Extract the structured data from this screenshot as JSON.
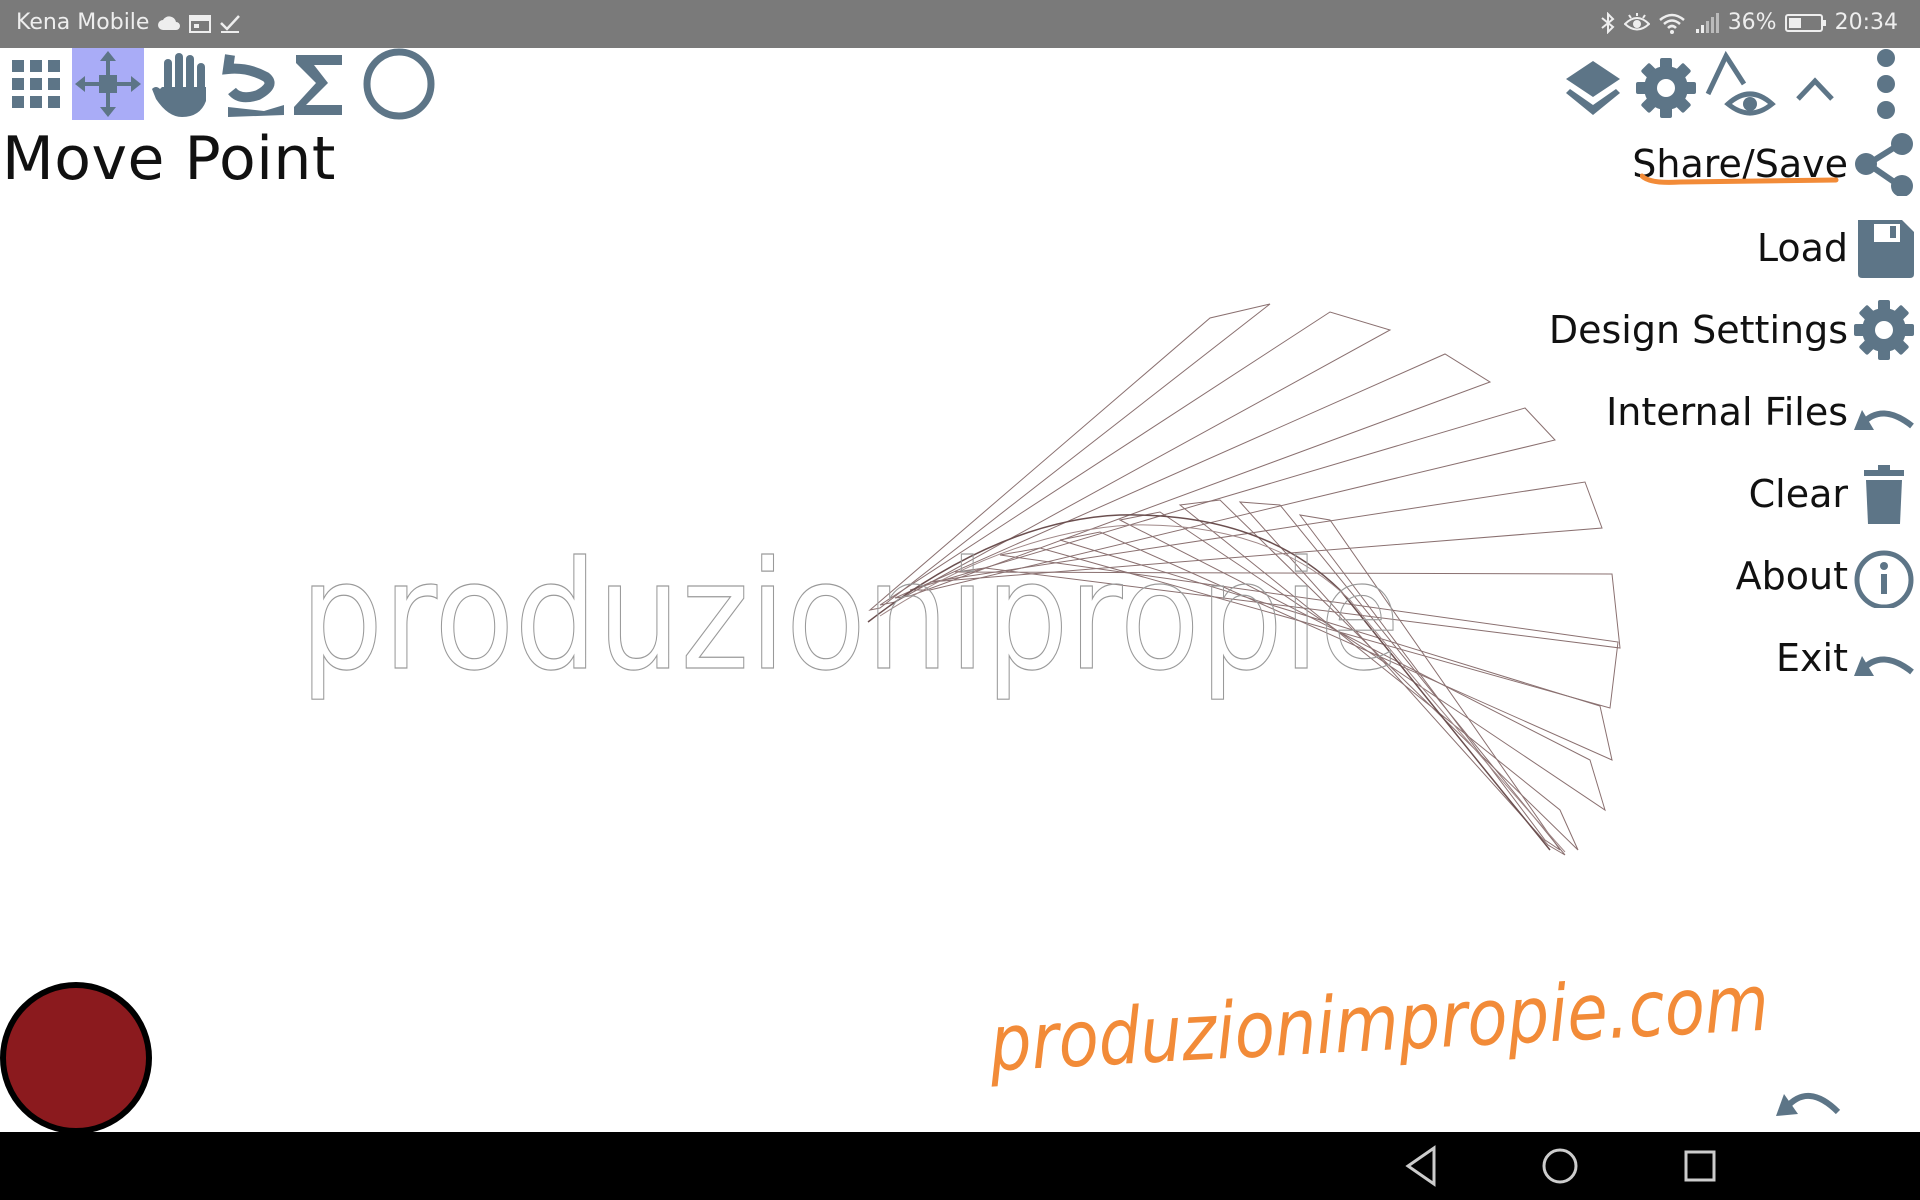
{
  "status_bar": {
    "carrier": "Kena Mobile",
    "battery": "36%",
    "time": "20:34"
  },
  "toolbar": {
    "active_tool": "move-point",
    "tools": [
      "grid",
      "move-point",
      "pan",
      "draw-curve",
      "sigma",
      "circle"
    ],
    "right_tools": [
      "layers",
      "settings",
      "visibility",
      "collapse",
      "more"
    ]
  },
  "mode_title": "Move Point",
  "menu": {
    "items": [
      {
        "label": "Share/Save",
        "icon": "share-icon"
      },
      {
        "label": "Load",
        "icon": "floppy-disk-icon"
      },
      {
        "label": "Design Settings",
        "icon": "gear-icon"
      },
      {
        "label": "Internal Files",
        "icon": "undo-arrow-icon"
      },
      {
        "label": "Clear",
        "icon": "trash-icon"
      },
      {
        "label": "About",
        "icon": "info-icon"
      },
      {
        "label": "Exit",
        "icon": "undo-arrow-icon"
      }
    ]
  },
  "canvas": {
    "outline_text": "produzionipropie",
    "signature_text": "produzionimpropie.com"
  },
  "colors": {
    "icon": "#5d7587",
    "active_tool_bg": "#a9acf7",
    "accent_orange": "#f28b38",
    "record_red": "#8b1a1e",
    "status_bar": "#7a7a7a"
  }
}
